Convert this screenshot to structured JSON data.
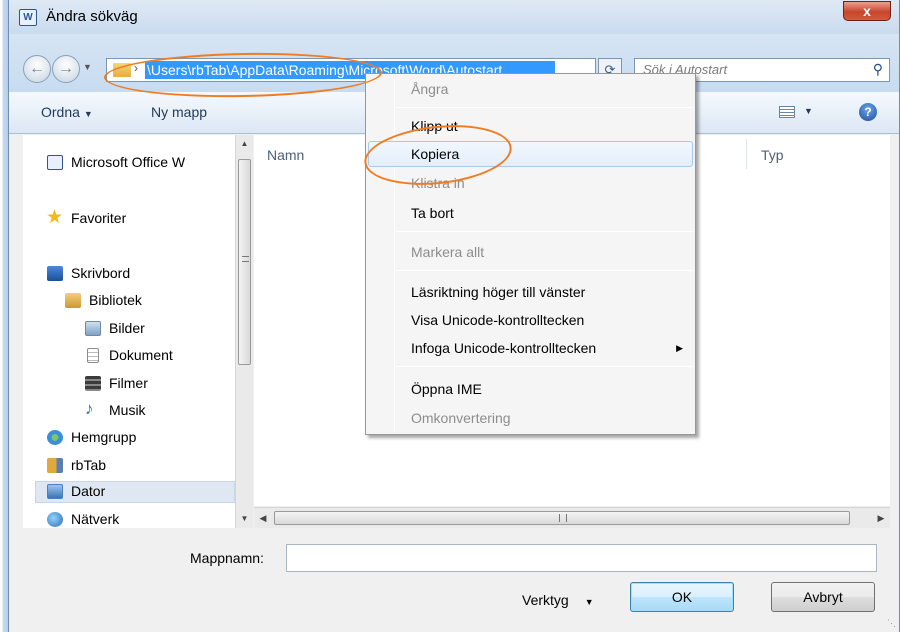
{
  "window": {
    "title": "Ändra sökväg",
    "close_label": "x",
    "title_icon_text": "W"
  },
  "nav": {
    "address_path": "\\Users\\rbTab\\AppData\\Roaming\\Microsoft\\Word\\Autostart",
    "search_placeholder": "Sök i Autostart"
  },
  "toolbar": {
    "organize_label": "Ordna",
    "new_folder_label": "Ny mapp"
  },
  "sidebar": {
    "items": [
      {
        "label": "Microsoft Office W",
        "icon": "word-icon",
        "color": "#2b5797"
      },
      {
        "label": "Favoriter",
        "icon": "star-icon",
        "color": "#f3b919"
      },
      {
        "label": "Skrivbord",
        "icon": "desktop-icon",
        "color": "#2a66b5"
      },
      {
        "label": "Bibliotek",
        "icon": "library-icon",
        "color": "#d9a43a"
      },
      {
        "label": "Bilder",
        "icon": "pictures-icon",
        "color": "#6d8aa8"
      },
      {
        "label": "Dokument",
        "icon": "documents-icon",
        "color": "#c9c9c9"
      },
      {
        "label": "Filmer",
        "icon": "videos-icon",
        "color": "#3b3b3b"
      },
      {
        "label": "Musik",
        "icon": "music-icon",
        "color": "#2e6fd1"
      },
      {
        "label": "Hemgrupp",
        "icon": "homegroup-icon",
        "color": "#3b8fd6"
      },
      {
        "label": "rbTab",
        "icon": "user-folder-icon",
        "color": "#e0a93a"
      },
      {
        "label": "Dator",
        "icon": "computer-icon",
        "color": "#4a7fc1"
      },
      {
        "label": "Nätverk",
        "icon": "network-icon",
        "color": "#2f6db0"
      }
    ]
  },
  "content": {
    "columns": [
      "Namn",
      "Typ"
    ]
  },
  "context_menu": {
    "items": [
      {
        "label": "Ångra",
        "disabled": true
      },
      {
        "label": "Klipp ut",
        "disabled": false
      },
      {
        "label": "Kopiera",
        "disabled": false
      },
      {
        "label": "Klistra in",
        "disabled": true
      },
      {
        "label": "Ta bort",
        "disabled": false
      },
      {
        "label": "Markera allt",
        "disabled": true
      },
      {
        "label": "Läsriktning höger till vänster",
        "disabled": false
      },
      {
        "label": "Visa Unicode-kontrolltecken",
        "disabled": false
      },
      {
        "label": "Infoga Unicode-kontrolltecken",
        "disabled": false
      },
      {
        "label": "Öppna IME",
        "disabled": false
      },
      {
        "label": "Omkonvertering",
        "disabled": true
      }
    ]
  },
  "footer": {
    "folder_name_label": "Mappnamn:",
    "folder_name_value": "",
    "tools_label": "Verktyg",
    "ok_label": "OK",
    "cancel_label": "Avbryt"
  },
  "colors": {
    "highlight_ring": "#f07c22",
    "selection": "#3399ff"
  }
}
